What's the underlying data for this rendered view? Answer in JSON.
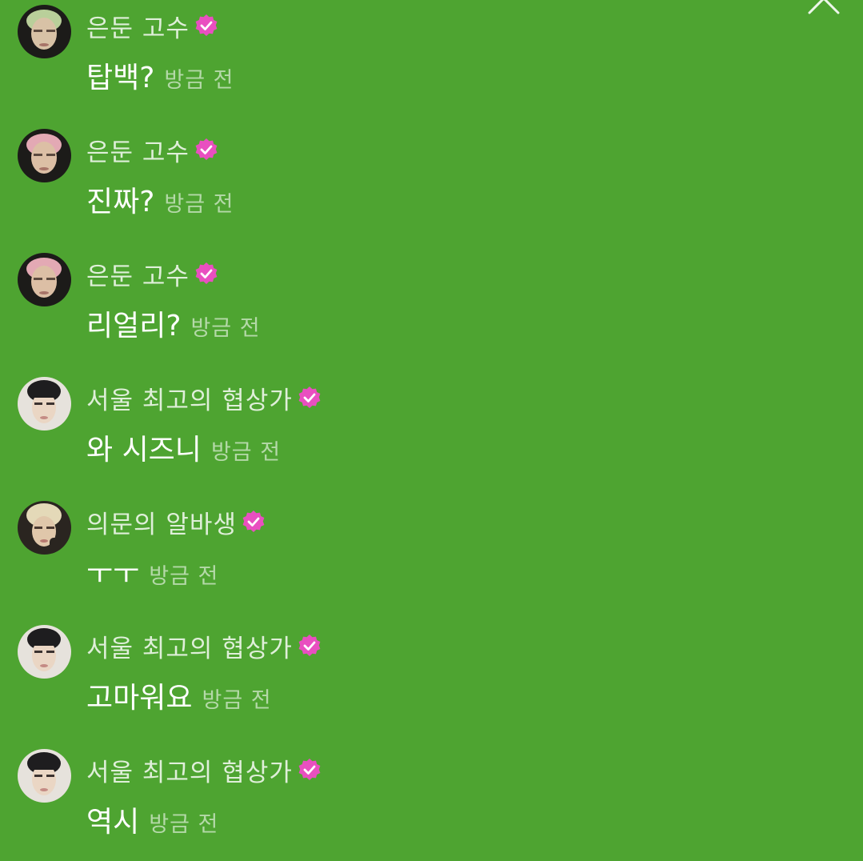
{
  "colors": {
    "background": "#4ea431",
    "badge": "#e94fc0"
  },
  "close_icon": "chevron-up-icon",
  "messages": [
    {
      "username": "은둔 고수",
      "text": "탑백?",
      "time": "방금 전",
      "avatar": "user-avatar",
      "verified": true
    },
    {
      "username": "은둔 고수",
      "text": "진짜?",
      "time": "방금 전",
      "avatar": "user-avatar",
      "verified": true
    },
    {
      "username": "은둔 고수",
      "text": "리얼리?",
      "time": "방금 전",
      "avatar": "user-avatar",
      "verified": true
    },
    {
      "username": "서울 최고의 협상가",
      "text": "와 시즈니",
      "time": "방금 전",
      "avatar": "user-avatar",
      "verified": true
    },
    {
      "username": "의문의 알바생",
      "text": "ㅜㅜ",
      "time": "방금 전",
      "avatar": "user-avatar",
      "verified": true
    },
    {
      "username": "서울 최고의 협상가",
      "text": "고마워요",
      "time": "방금 전",
      "avatar": "user-avatar",
      "verified": true
    },
    {
      "username": "서울 최고의 협상가",
      "text": "역시",
      "time": "방금 전",
      "avatar": "user-avatar",
      "verified": true
    }
  ]
}
